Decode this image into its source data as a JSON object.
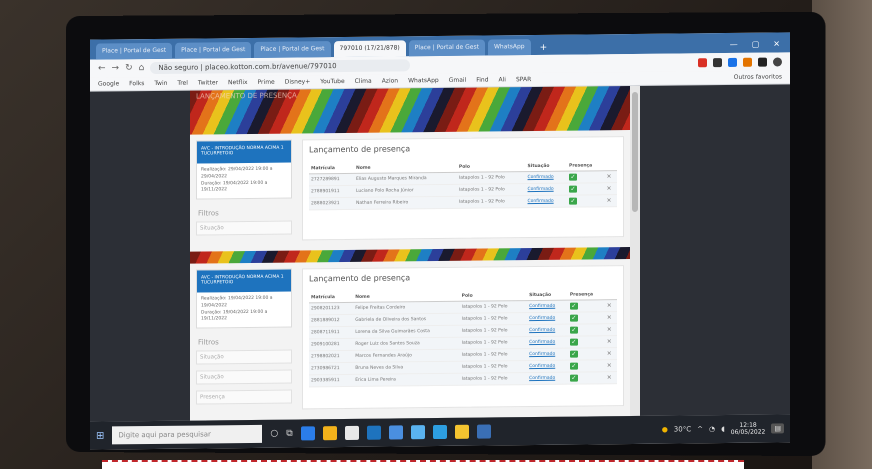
{
  "browser": {
    "tabs": [
      {
        "label": "Place | Portal de Gest"
      },
      {
        "label": "Place | Portal de Gest"
      },
      {
        "label": "Place | Portal de Gest"
      },
      {
        "label": "797010 (17/21/878)"
      },
      {
        "label": "Place | Portal de Gest"
      },
      {
        "label": "WhatsApp"
      }
    ],
    "active_tab": 3,
    "new_tab": "+",
    "url": "Não seguro | placeo.kotton.com.br/avenue/797010",
    "bookmarks": [
      "Google",
      "Folks",
      "Twin",
      "Trel",
      "Twitter",
      "Netflix",
      "Prime",
      "Disney+",
      "YouTube",
      "Clima",
      "Azion",
      "WhatsApp",
      "Gmail",
      "Find",
      "Ali",
      "SPAR"
    ],
    "bookmarks_right": "Outros favoritos"
  },
  "page": {
    "banner_title": "LANÇAMENTO DE PRESENÇA",
    "sections": [
      {
        "card_head": "AVC - INTRODUÇÃO NORMA ACIMA 1 TUCURPETOIO",
        "card_body_1": "Realização: 29/04/2022 19:00 a 29/04/2022",
        "card_body_2": "Duração: 19/04/2022 19:00 a 19/11/2022",
        "filter_label": "Filtros",
        "filter_placeholder": "Situação",
        "panel_title": "Lançamento de presença",
        "columns": [
          "Matrícula",
          "Nome",
          "Polo",
          "Situação",
          "Presença"
        ],
        "rows": [
          {
            "id": "2727289891",
            "name": "Elias Augusto Marques Miranda",
            "polo": "Iatapolos 1 - 92 Polo",
            "status": "Confirmado"
          },
          {
            "id": "2788901911",
            "name": "Luciano Polo Rocha Júnior",
            "polo": "Iatapolos 1 - 92 Polo",
            "status": "Confirmado"
          },
          {
            "id": "2888023921",
            "name": "Nathan Ferreira Ribeiro",
            "polo": "Iatapolos 1 - 92 Polo",
            "status": "Confirmado"
          }
        ]
      },
      {
        "card_head": "AVC - INTRODUÇÃO NORMA ACIMA 1 TUCURPETOIO",
        "card_body_1": "Realização: 19/04/2022 19:00 a 19/04/2022",
        "card_body_2": "Duração: 19/04/2022 19:00 a 19/11/2022",
        "filter_label": "Filtros",
        "filter_placeholder": "Situação",
        "filter2": "Situação",
        "filter3": "Presença",
        "panel_title": "Lançamento de presença",
        "columns": [
          "Matrícula",
          "Nome",
          "Polo",
          "Situação",
          "Presença"
        ],
        "rows": [
          {
            "id": "2908201123",
            "name": "Felipe Freitas Cordeiro",
            "polo": "Iatapolos 1 - 92 Polo",
            "status": "Confirmado"
          },
          {
            "id": "2881889012",
            "name": "Gabriela de Oliveira dos Santos",
            "polo": "Iatapolos 1 - 92 Polo",
            "status": "Confirmado"
          },
          {
            "id": "2808711911",
            "name": "Lorena da Silva Guimarães Costa",
            "polo": "Iatapolos 1 - 92 Polo",
            "status": "Confirmado"
          },
          {
            "id": "2909100281",
            "name": "Roger Luiz dos Santos Souza",
            "polo": "Iatapolos 1 - 92 Polo",
            "status": "Confirmado"
          },
          {
            "id": "2798802021",
            "name": "Marcos Fernandes Araújo",
            "polo": "Iatapolos 1 - 92 Polo",
            "status": "Confirmado"
          },
          {
            "id": "2730986721",
            "name": "Bruna Neves da Silva",
            "polo": "Iatapolos 1 - 92 Polo",
            "status": "Confirmado"
          },
          {
            "id": "2903385911",
            "name": "Erica Lima Pereira",
            "polo": "Iatapolos 1 - 92 Polo",
            "status": "Confirmado"
          }
        ]
      }
    ]
  },
  "taskbar": {
    "search_placeholder": "Digite aqui para pesquisar",
    "temperature": "30°C",
    "time": "12:18",
    "date": "06/05/2022"
  },
  "colors": {
    "accent": "#1e73be",
    "check": "#3aa64a",
    "tabbar": "#3c6fa8"
  }
}
